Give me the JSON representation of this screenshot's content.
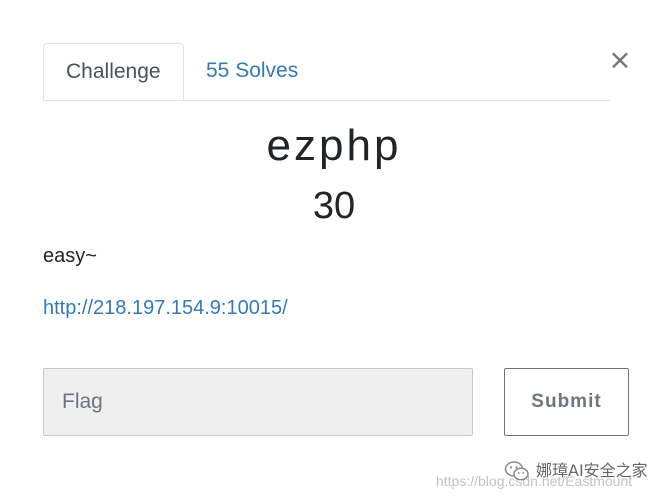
{
  "tabs": [
    {
      "label": "Challenge"
    },
    {
      "label": "55 Solves"
    }
  ],
  "close_label": "×",
  "challenge": {
    "name": "ezphp",
    "value": "30",
    "description": "easy~",
    "link": "http://218.197.154.9:10015/"
  },
  "form": {
    "flag_placeholder": "Flag",
    "flag_value": "",
    "submit_label": "Submit"
  },
  "watermark": {
    "name": "娜璋AI安全之家",
    "url": "https://blog.csdn.net/Eastmount",
    "icon": "wechat-icon"
  },
  "colors": {
    "link": "#337ab7",
    "text": "#212529",
    "muted": "#6c757d",
    "input_bg": "#efefef"
  }
}
